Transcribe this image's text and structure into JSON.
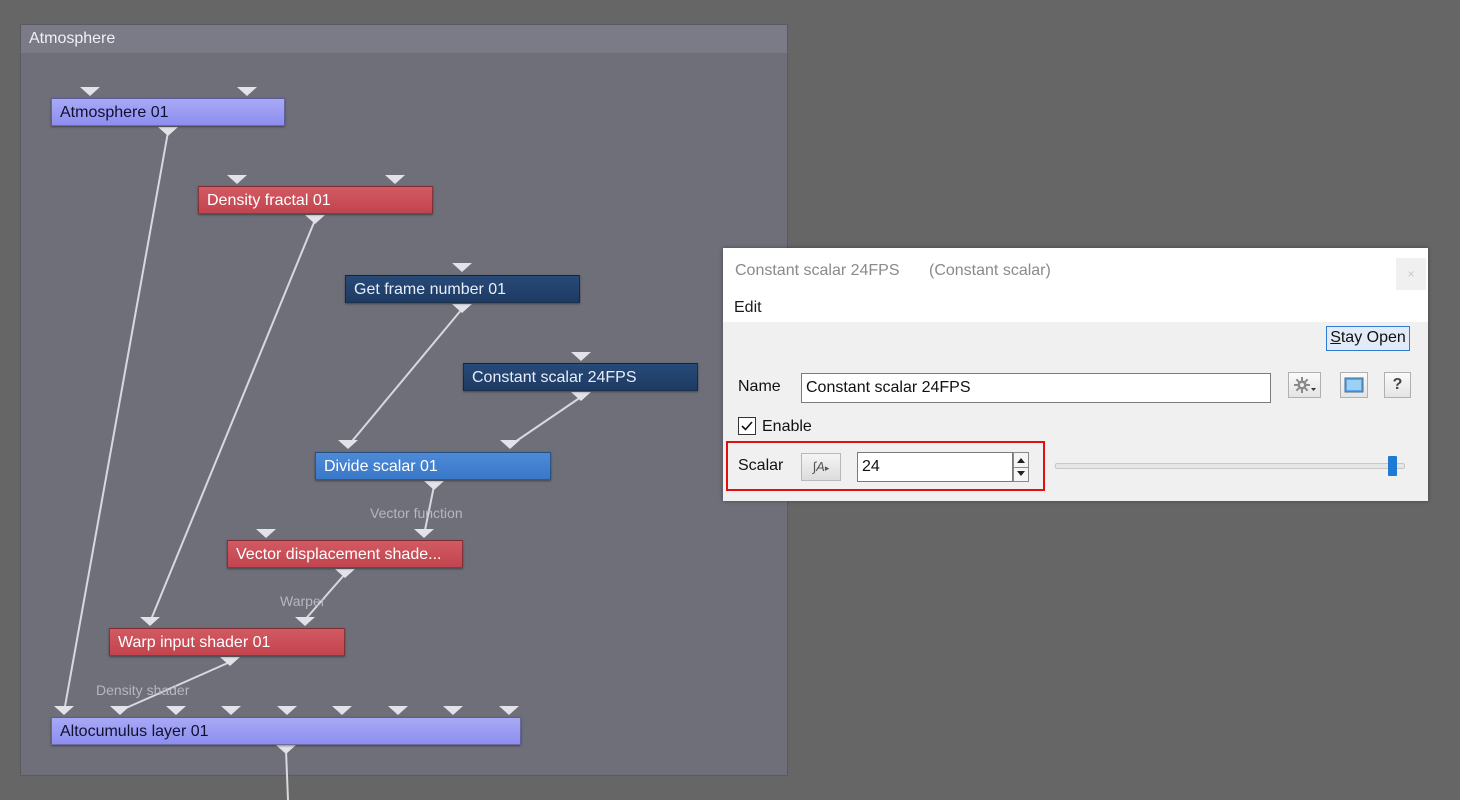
{
  "graph": {
    "title": "Atmosphere",
    "nodes": {
      "atmosphere": "Atmosphere 01",
      "density_fractal": "Density fractal 01",
      "get_frame": "Get frame number 01",
      "constant_scalar": "Constant scalar 24FPS",
      "divide_scalar": "Divide scalar 01",
      "vector_displacement": "Vector displacement shade...",
      "warp_input": "Warp input shader 01",
      "altocumulus": "Altocumulus layer 01"
    },
    "wire_labels": {
      "vector_function": "Vector function",
      "warper": "Warper",
      "density_shader": "Density shader"
    }
  },
  "dialog": {
    "title": "Constant scalar 24FPS",
    "subtitle": "(Constant scalar)",
    "close_label": "×",
    "menu_edit": "Edit",
    "stay_open": "Stay Open",
    "name_label": "Name",
    "name_value": "Constant scalar 24FPS",
    "enable_label": "Enable",
    "enable_checked": true,
    "help_label": "?",
    "scalar_label": "Scalar",
    "scalar_value": "24",
    "fx_label": "∫A",
    "slider_fraction": 0.98
  },
  "colors": {
    "node_lavender": "#8d8ef0",
    "node_red": "#c2444e",
    "node_navy": "#1d3a63",
    "node_blue": "#3a78c8",
    "highlight_frame": "#e01010",
    "accent": "#1e7ad4"
  }
}
